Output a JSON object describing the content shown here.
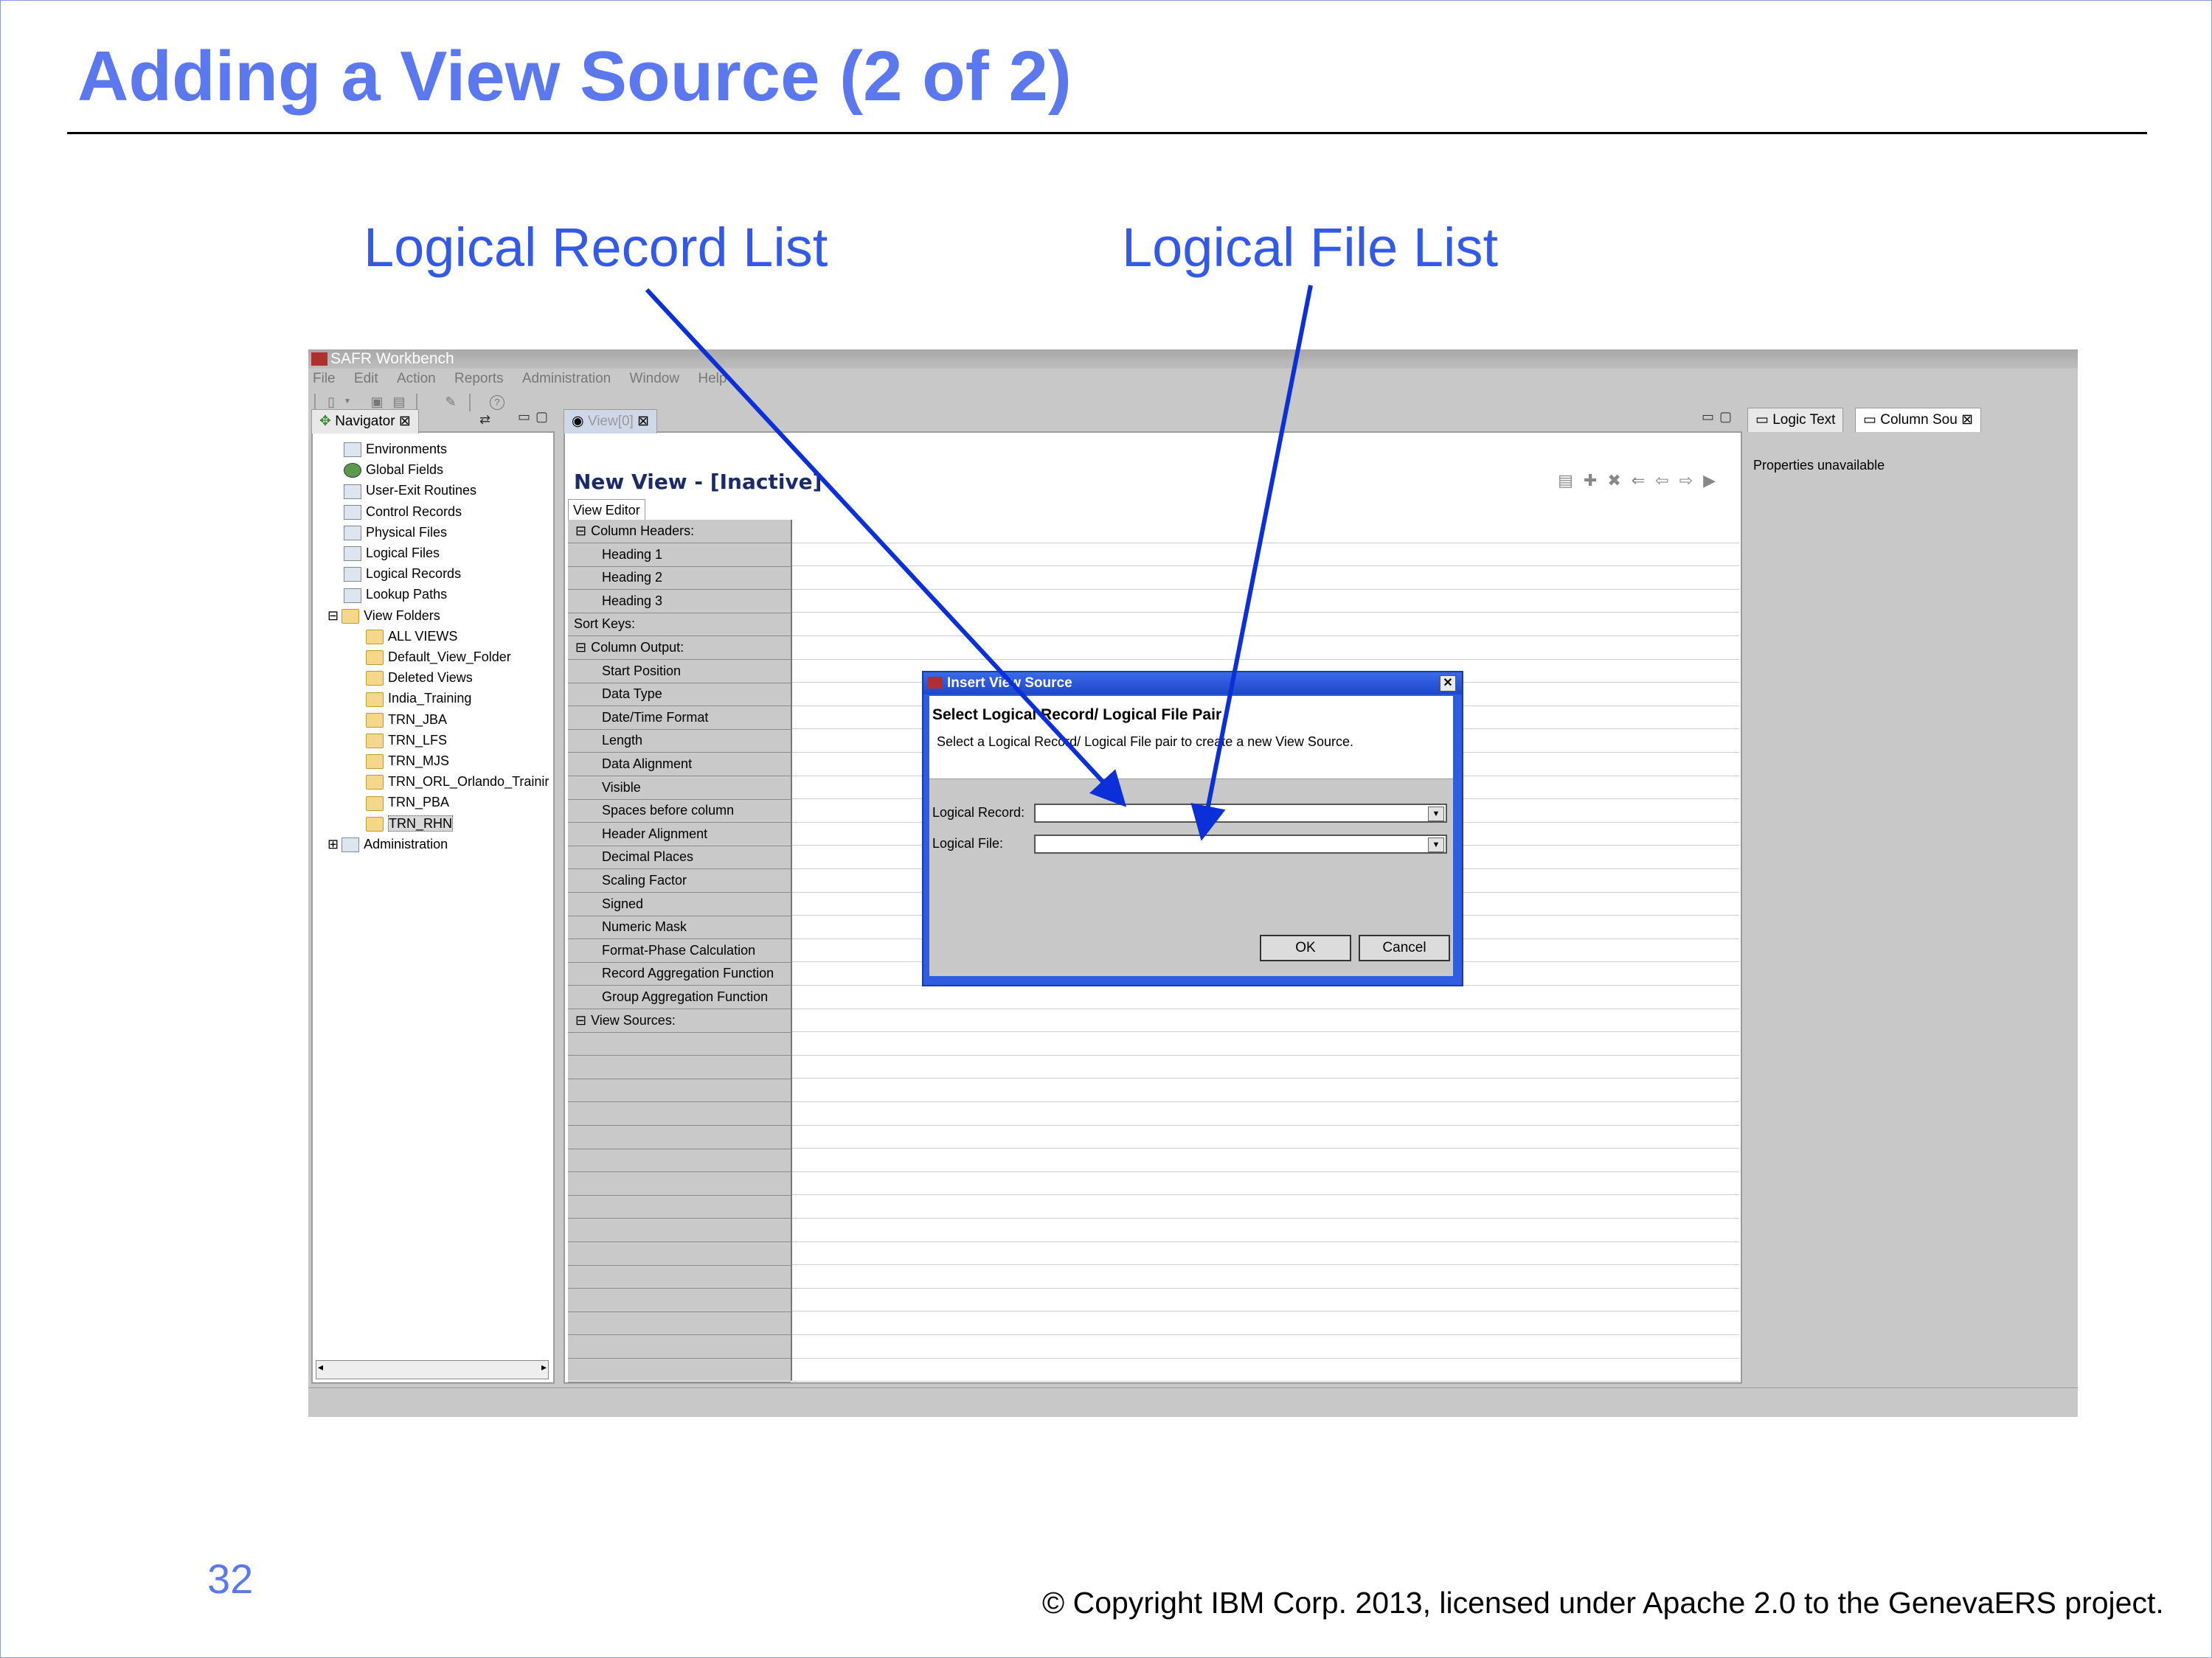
{
  "slide": {
    "title": "Adding a View Source (2 of 2)",
    "callout_record": "Logical Record List",
    "callout_file": "Logical File List",
    "slide_number": "32",
    "copyright": "© Copyright IBM Corp. 2013, licensed under Apache 2.0 to the GenevaERS project."
  },
  "app": {
    "window_title": "SAFR Workbench",
    "menu": [
      "File",
      "Edit",
      "Action",
      "Reports",
      "Administration",
      "Window",
      "Help"
    ]
  },
  "navigator": {
    "tab_label": "Navigator",
    "items": [
      {
        "label": "Environments",
        "icon": "environments-icon"
      },
      {
        "label": "Global Fields",
        "icon": "globe-icon"
      },
      {
        "label": "User-Exit Routines",
        "icon": "user-exit-icon"
      },
      {
        "label": "Control Records",
        "icon": "control-records-icon"
      },
      {
        "label": "Physical Files",
        "icon": "physical-files-icon"
      },
      {
        "label": "Logical Files",
        "icon": "logical-files-icon"
      },
      {
        "label": "Logical Records",
        "icon": "logical-records-icon"
      },
      {
        "label": "Lookup Paths",
        "icon": "lookup-paths-icon"
      },
      {
        "label": "View Folders",
        "icon": "folder-icon"
      },
      {
        "label": "ALL VIEWS",
        "icon": "folder-icon"
      },
      {
        "label": "Default_View_Folder",
        "icon": "folder-icon"
      },
      {
        "label": "Deleted Views",
        "icon": "folder-icon"
      },
      {
        "label": "India_Training",
        "icon": "folder-icon"
      },
      {
        "label": "TRN_JBA",
        "icon": "folder-icon"
      },
      {
        "label": "TRN_LFS",
        "icon": "folder-icon"
      },
      {
        "label": "TRN_MJS",
        "icon": "folder-icon"
      },
      {
        "label": "TRN_ORL_Orlando_Trainir",
        "icon": "folder-icon"
      },
      {
        "label": "TRN_PBA",
        "icon": "folder-icon"
      },
      {
        "label": "TRN_RHN",
        "icon": "folder-icon"
      },
      {
        "label": "Administration",
        "icon": "administration-icon"
      }
    ]
  },
  "editor": {
    "tab_label": "View[0]",
    "title": "New View - [Inactive]",
    "subtab": "View Editor",
    "rows": [
      "Column Headers:",
      "Heading 1",
      "Heading 2",
      "Heading 3",
      "Sort Keys:",
      "Column Output:",
      "Start Position",
      "Data Type",
      "Date/Time Format",
      "Length",
      "Data Alignment",
      "Visible",
      "Spaces before column",
      "Header Alignment",
      "Decimal Places",
      "Scaling Factor",
      "Signed",
      "Numeric Mask",
      "Format-Phase Calculation",
      "Record Aggregation Function",
      "Group Aggregation Function",
      "View Sources:"
    ]
  },
  "properties": {
    "tab_logic": "Logic Text",
    "tab_column": "Column Sou",
    "message": "Properties unavailable"
  },
  "dialog": {
    "title": "Insert View Source",
    "heading": "Select Logical Record/ Logical File Pair",
    "description": "Select a Logical Record/ Logical File pair to create a new View Source.",
    "record_label": "Logical Record:",
    "file_label": "Logical File:",
    "ok": "OK",
    "cancel": "Cancel"
  }
}
